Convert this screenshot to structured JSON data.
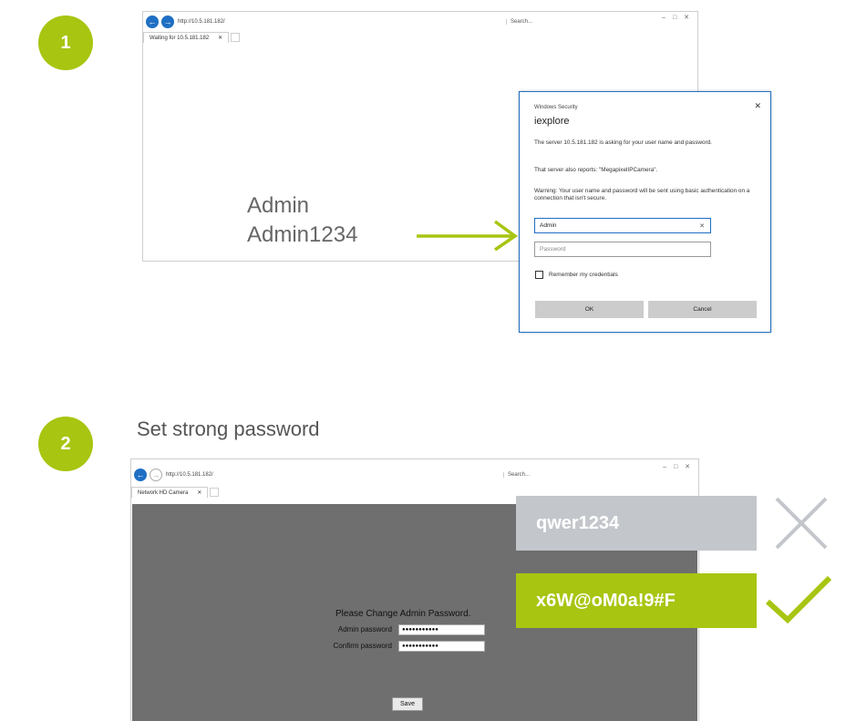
{
  "step1": {
    "badge": "1",
    "browser": {
      "url": "http://10.5.181.182/",
      "tab_label": "Waiting for 10.5.181.182",
      "search_placeholder": "Search..."
    },
    "dialog": {
      "header": "Windows Security",
      "app_name": "iexplore",
      "para1": "The server 10.5.181.182 is asking for your user name and password.",
      "para2": "That server also reports: \"MegapixelIPCamera\".",
      "para3": "Warning: Your user name and password will be sent using basic authentication on a connection that isn't secure.",
      "username_value": "Admin",
      "password_placeholder": "Password",
      "remember_label": "Remember my credentials",
      "ok_label": "OK",
      "cancel_label": "Cancel"
    },
    "annotation": {
      "username": "Admin",
      "password": "Admin1234"
    }
  },
  "step2": {
    "badge": "2",
    "subtitle": "Set strong password",
    "browser": {
      "url": "http://10.5.181.182/",
      "tab_label": "Network HD Camera",
      "search_placeholder": "Search..."
    },
    "form": {
      "title": "Please Change Admin Password.",
      "admin_label": "Admin password",
      "confirm_label": "Confirm password",
      "admin_value": "●●●●●●●●●●●",
      "confirm_value": "●●●●●●●●●●●",
      "save_label": "Save"
    },
    "examples": {
      "bad": "qwer1234",
      "good": "x6W@oM0a!9#F"
    }
  },
  "colors": {
    "accent_green": "#a8c511",
    "bad_gray": "#c3c6cb",
    "dialog_blue": "#1f6fc4"
  }
}
